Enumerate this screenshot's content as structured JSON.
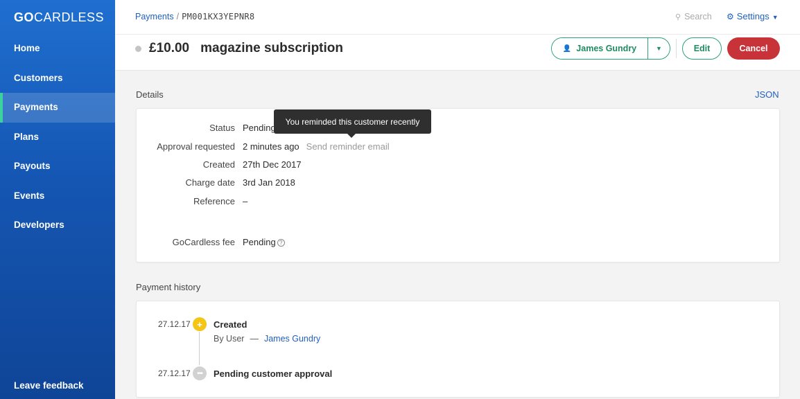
{
  "logo": {
    "bold": "GO",
    "rest": "CARDLESS"
  },
  "sidebar": {
    "items": [
      {
        "label": "Home"
      },
      {
        "label": "Customers"
      },
      {
        "label": "Payments"
      },
      {
        "label": "Plans"
      },
      {
        "label": "Payouts"
      },
      {
        "label": "Events"
      },
      {
        "label": "Developers"
      }
    ],
    "active_item": "Payments",
    "feedback_label": "Leave feedback"
  },
  "header": {
    "breadcrumb": {
      "parent": "Payments",
      "separator": "/",
      "current": "PM001KX3YEPNR8"
    },
    "search_placeholder": "Search",
    "settings_label": "Settings",
    "amount": "£10.00",
    "description": "magazine subscription",
    "customer_button": "James Gundry",
    "edit_label": "Edit",
    "cancel_label": "Cancel"
  },
  "details": {
    "section_label": "Details",
    "json_link": "JSON",
    "rows": [
      {
        "label": "Status",
        "value": "Pending"
      },
      {
        "label": "Approval requested",
        "value": "2 minutes ago",
        "action": "Send reminder email"
      },
      {
        "label": "Created",
        "value": "27th Dec 2017"
      },
      {
        "label": "Charge date",
        "value": "3rd Jan 2018"
      },
      {
        "label": "Reference",
        "value": "–"
      },
      {
        "label": "GoCardless fee",
        "value": "Pending"
      }
    ],
    "tooltip": "You reminded this customer recently"
  },
  "history": {
    "section_label": "Payment history",
    "events": [
      {
        "date": "27.12.17",
        "title": "Created",
        "by_label": "By User",
        "dash": "—",
        "by_name": "James Gundry"
      },
      {
        "date": "27.12.17",
        "title": "Pending customer approval"
      }
    ]
  },
  "colors": {
    "sidebar": "#1556b3",
    "accent_green": "#2aa274",
    "cancel_red": "#c8333a",
    "link_blue": "#1f5fbf",
    "created_yellow": "#f4c416"
  }
}
